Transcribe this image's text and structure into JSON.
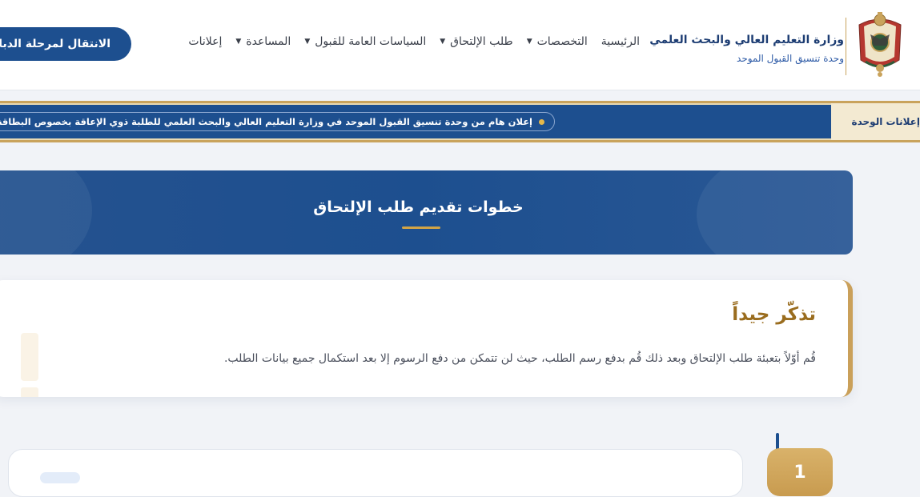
{
  "brand": {
    "title": "وزارة التعليم العالي والبحث العلمي",
    "subtitle": "وحدة تنسيق القبول الموحد",
    "emblem_icon": "jordan-coat-of-arms-icon"
  },
  "nav": {
    "items": [
      {
        "label": "الرئيسية",
        "has_dropdown": false
      },
      {
        "label": "التخصصات",
        "has_dropdown": true
      },
      {
        "label": "طلب الإلتحاق",
        "has_dropdown": true
      },
      {
        "label": "السياسات العامة للقبول",
        "has_dropdown": true
      },
      {
        "label": "المساعدة",
        "has_dropdown": true
      },
      {
        "label": "إعلانات",
        "has_dropdown": false
      }
    ],
    "cta_label": "الانتقال لمرحلة الدبلوم"
  },
  "ticker": {
    "label": "إعلانات الوحدة",
    "headline": "إعلان هام من وحدة تنسيق القبول الموحد في وزارة التعليم العالي والبحث العلمي للطلبة ذوي الإعاقة بخصوص البطاقة"
  },
  "banner": {
    "title": "خطوات تقديم طلب الإلتحاق"
  },
  "reminder": {
    "title": "تذكّر جيداً",
    "text": "قُم أوّلاً بتعبئة طلب الإلتحاق وبعد ذلك قُم بدفع رسم الطلب، حيث لن تتمكن من دفع الرسوم إلا بعد استكمال جميع بيانات الطلب."
  },
  "step": {
    "number": "1"
  },
  "colors": {
    "primary": "#1d4f8f",
    "gold": "#c9a35c",
    "background": "#f1f3f7"
  }
}
